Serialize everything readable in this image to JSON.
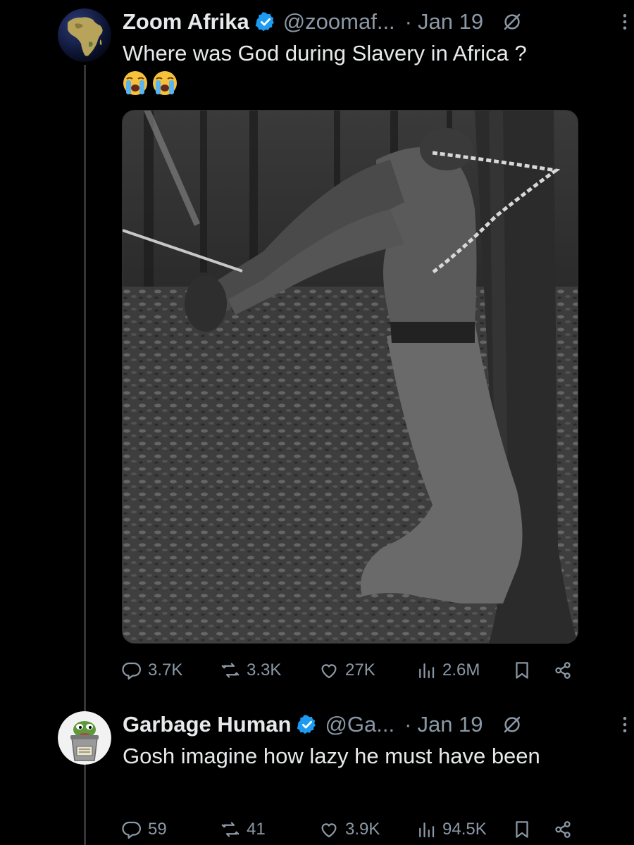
{
  "tweets": [
    {
      "display_name": "Zoom Afrika",
      "handle": "@zoomaf...",
      "separator": "·",
      "date": "Jan 19",
      "text": "Where was God during Slavery in Africa ?",
      "emojis": [
        "loudly-crying-face",
        "loudly-crying-face"
      ],
      "replies": "3.7K",
      "retweets": "3.3K",
      "likes": "27K",
      "views": "2.6M",
      "avatar_icon": "africa-globe-icon",
      "media_description_icon": "bw-photo"
    },
    {
      "display_name": "Garbage Human",
      "handle": "@Ga...",
      "separator": "·",
      "date": "Jan 19",
      "text": "Gosh imagine how lazy he must have been",
      "replies": "59",
      "retweets": "41",
      "likes": "3.9K",
      "views": "94.5K",
      "avatar_icon": "trash-can-frog-icon",
      "avatar_label": "GARBAGE HUMAN"
    }
  ],
  "colors": {
    "background": "#000000",
    "text_primary": "#e7e9ea",
    "text_secondary": "#8b98a5",
    "verified_blue": "#1d9bf0",
    "thread_line": "#333639"
  }
}
